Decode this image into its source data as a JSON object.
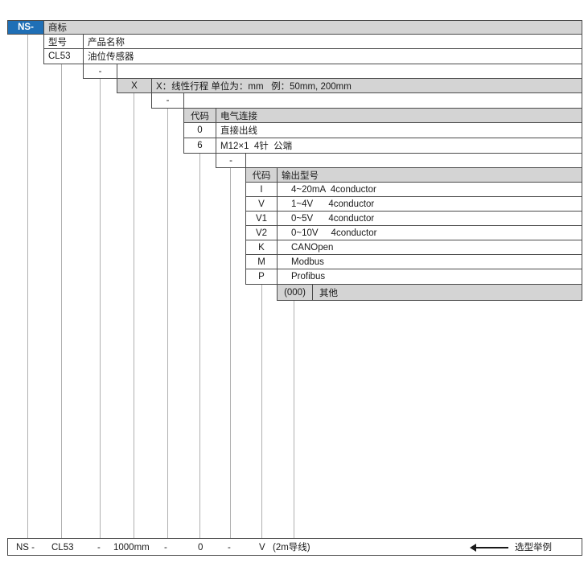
{
  "header": {
    "brand_code": "NS-",
    "brand_label": "商标",
    "model_label": "型号",
    "product_name_label": "产品名称",
    "model_value": "CL53",
    "product_name_value": "油位传感器"
  },
  "stroke": {
    "dash": "-",
    "code": "X",
    "desc": "X：线性行程 单位为：mm   例：50mm, 200mm"
  },
  "electrical": {
    "dash": "-",
    "code_header": "代码",
    "title": "电气连接",
    "rows": [
      {
        "code": "0",
        "desc": "直接出线"
      },
      {
        "code": "6",
        "desc": "M12×1  4针  公端"
      }
    ]
  },
  "output": {
    "dash": "-",
    "code_header": "代码",
    "title": "输出型号",
    "rows": [
      {
        "code": "I",
        "desc": "4~20mA  4conductor"
      },
      {
        "code": "V",
        "desc": "1~4V      4conductor"
      },
      {
        "code": "V1",
        "desc": "0~5V      4conductor"
      },
      {
        "code": "V2",
        "desc": "0~10V     4conductor"
      },
      {
        "code": "K",
        "desc": "CANOpen"
      },
      {
        "code": "M",
        "desc": "Modbus"
      },
      {
        "code": "P",
        "desc": "Profibus"
      }
    ]
  },
  "other": {
    "code": "(000)",
    "label": "其他"
  },
  "example": {
    "parts": [
      "NS -",
      "CL53",
      "-",
      "1000mm",
      "-",
      "0",
      "-",
      "V",
      "(2m导线)"
    ],
    "caption": "选型举例"
  },
  "colors": {
    "brand": "#1f6fb6",
    "header_gray": "#d4d4d4",
    "border": "#4a4a4a",
    "guide": "#b0b0b0"
  }
}
